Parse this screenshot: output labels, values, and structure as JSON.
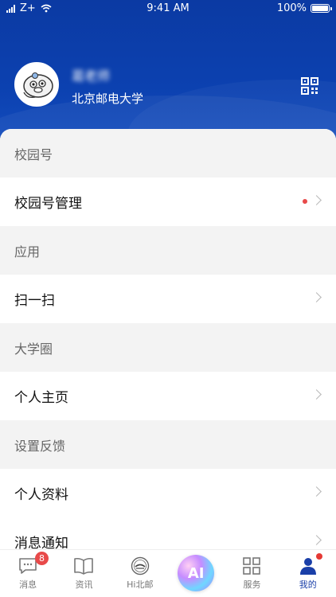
{
  "status_bar": {
    "carrier": "Z+",
    "time": "9:41 AM",
    "battery": "100%"
  },
  "profile": {
    "name": "葛老师",
    "school": "北京邮电大学"
  },
  "sections": [
    {
      "title": "校园号",
      "items": [
        {
          "label": "校园号管理",
          "has_dot": true
        }
      ]
    },
    {
      "title": "应用",
      "items": [
        {
          "label": "扫一扫"
        }
      ]
    },
    {
      "title": "大学圈",
      "items": [
        {
          "label": "个人主页"
        }
      ]
    },
    {
      "title": "设置反馈",
      "items": [
        {
          "label": "个人资料"
        },
        {
          "label": "消息通知"
        }
      ]
    }
  ],
  "tabbar": [
    {
      "label": "消息",
      "icon": "chat-icon",
      "badge": "8"
    },
    {
      "label": "资讯",
      "icon": "book-icon"
    },
    {
      "label": "Hi北邮",
      "icon": "school-logo-icon"
    },
    {
      "label": "AI",
      "icon": "ai-icon"
    },
    {
      "label": "服务",
      "icon": "grid-icon"
    },
    {
      "label": "我的",
      "icon": "person-icon",
      "active": true
    }
  ],
  "colors": {
    "brand_blue": "#0c41b0",
    "badge_red": "#e84a4a",
    "active_tab": "#1a3fa8"
  }
}
